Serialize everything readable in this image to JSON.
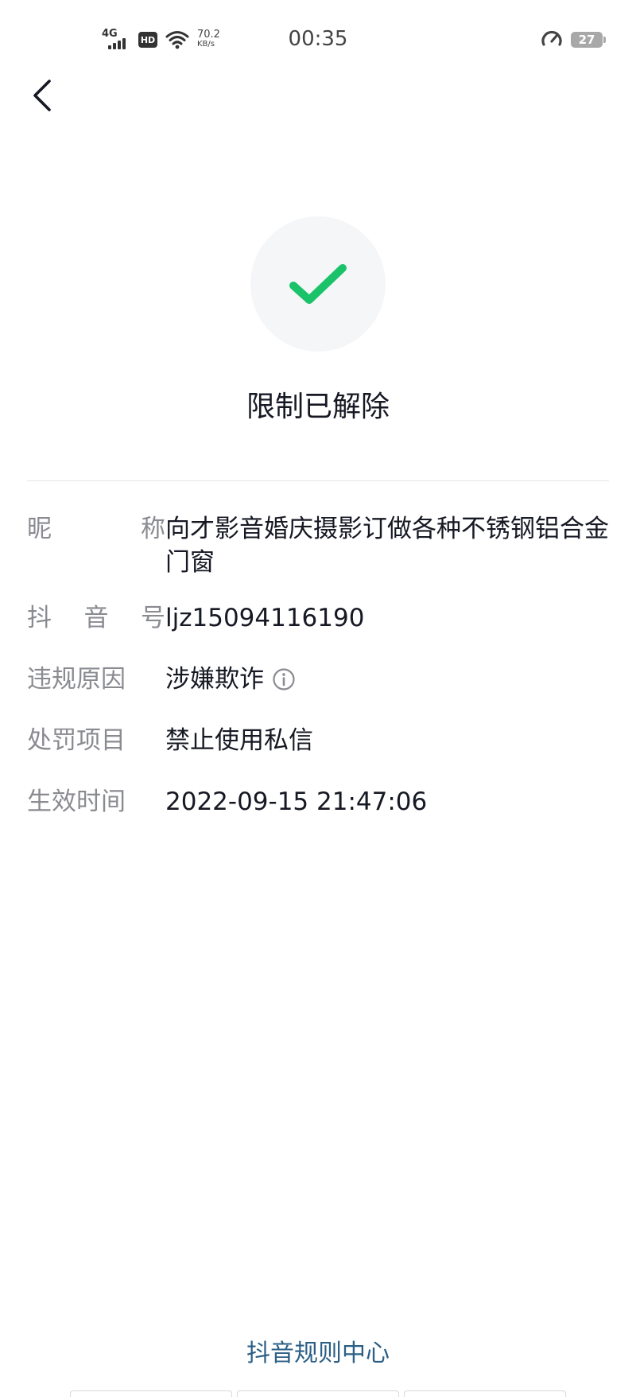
{
  "status_bar": {
    "network": "4G",
    "hd": "HD",
    "speed_value": "70.2",
    "speed_unit": "KB/s",
    "time": "00:35",
    "battery": "27"
  },
  "page": {
    "title": "限制已解除",
    "success_color": "#1ac26a"
  },
  "details": {
    "nickname_label": [
      "昵",
      "称"
    ],
    "nickname_value": "向才影音婚庆摄影订做各种不锈钢铝合金门窗",
    "douyin_id_label": [
      "抖",
      "音",
      "号"
    ],
    "douyin_id_value": "ljz15094116190",
    "reason_label": "违规原因",
    "reason_value": "涉嫌欺诈",
    "penalty_label": "处罚项目",
    "penalty_value": "禁止使用私信",
    "effective_label": "生效时间",
    "effective_value": "2022-09-15 21:47:06"
  },
  "footer": {
    "rules_link": "抖音规则中心"
  }
}
